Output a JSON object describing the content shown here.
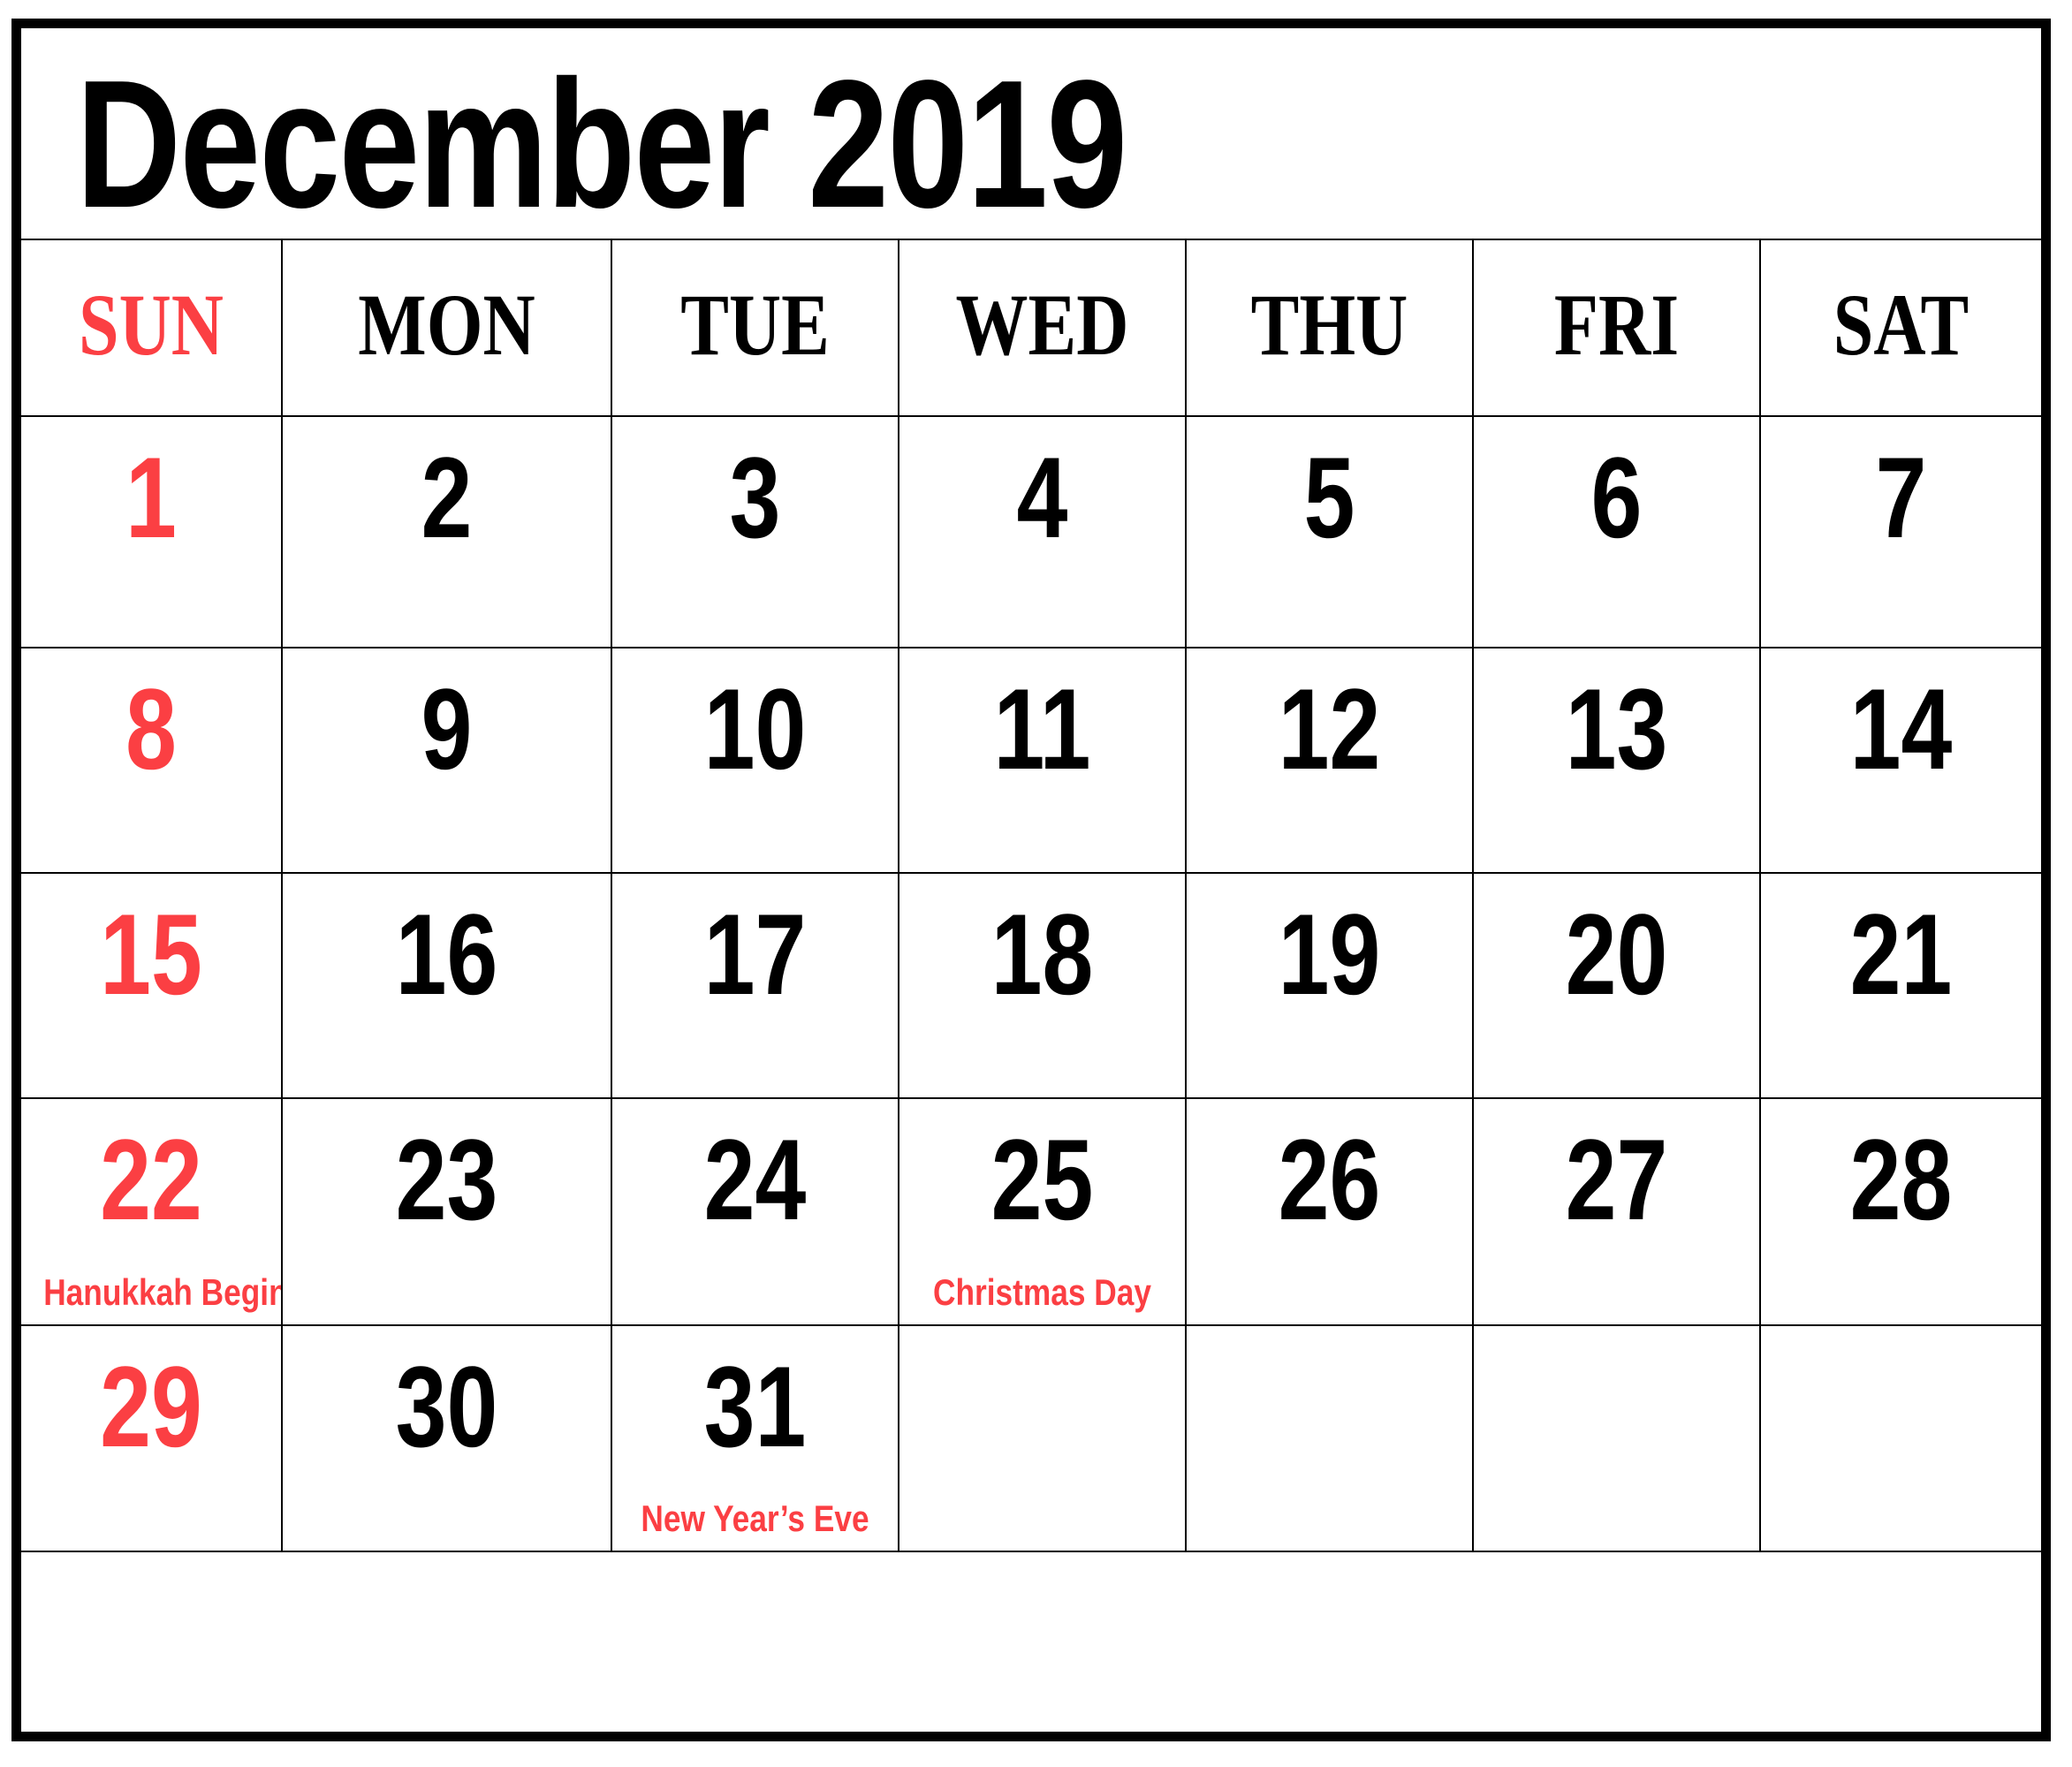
{
  "calendar": {
    "title": "December 2019",
    "month": "December",
    "year": "2019",
    "accent_color": "#fb3f43",
    "text_color": "#000000",
    "background_color": "#ffffff",
    "weekdays": [
      {
        "label": "SUN",
        "highlight": true
      },
      {
        "label": "MON",
        "highlight": false
      },
      {
        "label": "TUE",
        "highlight": false
      },
      {
        "label": "WED",
        "highlight": false
      },
      {
        "label": "THU",
        "highlight": false
      },
      {
        "label": "FRI",
        "highlight": false
      },
      {
        "label": "SAT",
        "highlight": false
      }
    ],
    "weeks": [
      [
        {
          "day": "1",
          "sunday": true,
          "event": ""
        },
        {
          "day": "2",
          "sunday": false,
          "event": ""
        },
        {
          "day": "3",
          "sunday": false,
          "event": ""
        },
        {
          "day": "4",
          "sunday": false,
          "event": ""
        },
        {
          "day": "5",
          "sunday": false,
          "event": ""
        },
        {
          "day": "6",
          "sunday": false,
          "event": ""
        },
        {
          "day": "7",
          "sunday": false,
          "event": ""
        }
      ],
      [
        {
          "day": "8",
          "sunday": true,
          "event": ""
        },
        {
          "day": "9",
          "sunday": false,
          "event": ""
        },
        {
          "day": "10",
          "sunday": false,
          "event": ""
        },
        {
          "day": "11",
          "sunday": false,
          "event": ""
        },
        {
          "day": "12",
          "sunday": false,
          "event": ""
        },
        {
          "day": "13",
          "sunday": false,
          "event": ""
        },
        {
          "day": "14",
          "sunday": false,
          "event": ""
        }
      ],
      [
        {
          "day": "15",
          "sunday": true,
          "event": ""
        },
        {
          "day": "16",
          "sunday": false,
          "event": ""
        },
        {
          "day": "17",
          "sunday": false,
          "event": ""
        },
        {
          "day": "18",
          "sunday": false,
          "event": ""
        },
        {
          "day": "19",
          "sunday": false,
          "event": ""
        },
        {
          "day": "20",
          "sunday": false,
          "event": ""
        },
        {
          "day": "21",
          "sunday": false,
          "event": ""
        }
      ],
      [
        {
          "day": "22",
          "sunday": true,
          "event": "Hanukkah Begins"
        },
        {
          "day": "23",
          "sunday": false,
          "event": ""
        },
        {
          "day": "24",
          "sunday": false,
          "event": ""
        },
        {
          "day": "25",
          "sunday": false,
          "event": "Christmas Day"
        },
        {
          "day": "26",
          "sunday": false,
          "event": ""
        },
        {
          "day": "27",
          "sunday": false,
          "event": ""
        },
        {
          "day": "28",
          "sunday": false,
          "event": ""
        }
      ],
      [
        {
          "day": "29",
          "sunday": true,
          "event": ""
        },
        {
          "day": "30",
          "sunday": false,
          "event": ""
        },
        {
          "day": "31",
          "sunday": false,
          "event": "New Year’s Eve"
        },
        {
          "day": "",
          "sunday": false,
          "event": ""
        },
        {
          "day": "",
          "sunday": false,
          "event": ""
        },
        {
          "day": "",
          "sunday": false,
          "event": ""
        },
        {
          "day": "",
          "sunday": false,
          "event": ""
        }
      ]
    ],
    "notes_band": ""
  }
}
